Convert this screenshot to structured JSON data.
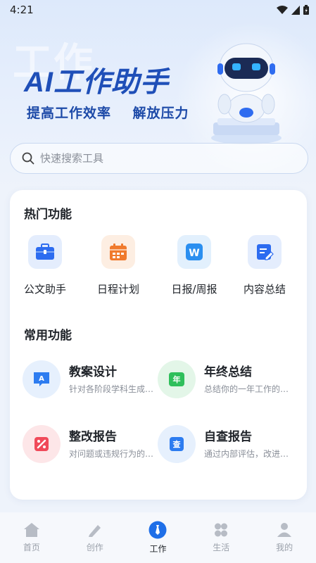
{
  "status_bar": {
    "time": "4:21"
  },
  "hero": {
    "ghost_text": "工作",
    "title": "AI工作助手",
    "subtitle": "提高工作效率    解放压力"
  },
  "search": {
    "placeholder": "快速搜索工具",
    "icon": "search-icon"
  },
  "hot_features": {
    "title": "热门功能",
    "items": [
      {
        "label": "公文助手",
        "icon": "briefcase-icon",
        "color": "#2d6cf0"
      },
      {
        "label": "日程计划",
        "icon": "calendar-icon",
        "color": "#f07a2d"
      },
      {
        "label": "日报/周报",
        "icon": "word-doc-icon",
        "color": "#2b8ff0"
      },
      {
        "label": "内容总结",
        "icon": "edit-note-icon",
        "color": "#2d6cf0"
      }
    ]
  },
  "common_features": {
    "title": "常用功能",
    "items": [
      {
        "title": "教案设计",
        "desc": "针对各阶段学科生成教案",
        "icon": "lesson-plan-icon",
        "badge": "A",
        "color": "#2d7cf0"
      },
      {
        "title": "年终总结",
        "desc": "总结你的一年工作的成果",
        "icon": "year-summary-icon",
        "badge": "年",
        "color": "#2fbf5b"
      },
      {
        "title": "整改报告",
        "desc": "对问题或违规行为的整改",
        "icon": "rectification-icon",
        "badge": "",
        "color": "#f04a5a"
      },
      {
        "title": "自查报告",
        "desc": "通过内部评估，改进工作",
        "icon": "self-check-icon",
        "badge": "查",
        "color": "#2d7cf0"
      }
    ]
  },
  "tab_bar": {
    "tabs": [
      {
        "label": "首页",
        "icon": "home-icon",
        "active": false
      },
      {
        "label": "创作",
        "icon": "pencil-icon",
        "active": false
      },
      {
        "label": "工作",
        "icon": "tie-icon",
        "active": true
      },
      {
        "label": "生活",
        "icon": "clover-icon",
        "active": false
      },
      {
        "label": "我的",
        "icon": "user-icon",
        "active": false
      }
    ]
  },
  "colors": {
    "accent": "#1f6fe8",
    "title_blue": "#1f4fb8",
    "background": "#eef3fb"
  }
}
